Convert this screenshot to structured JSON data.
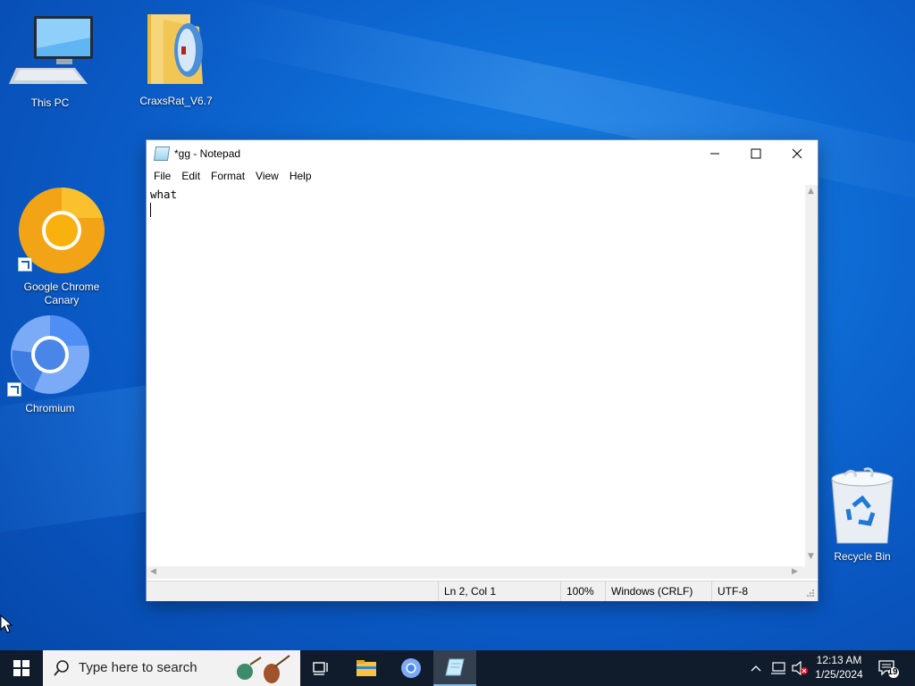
{
  "desktop": {
    "icons": [
      {
        "label": "This PC"
      },
      {
        "label": "CraxsRat_V6.7"
      },
      {
        "label_line1": "Google Chrome",
        "label_line2": "Canary"
      },
      {
        "label": "Chromium"
      },
      {
        "label": "Recycle Bin"
      }
    ]
  },
  "notepad": {
    "title": "*gg - Notepad",
    "menu": [
      "File",
      "Edit",
      "Format",
      "View",
      "Help"
    ],
    "content": "what",
    "status": {
      "position": "Ln 2, Col 1",
      "zoom": "100%",
      "line_ending": "Windows (CRLF)",
      "encoding": "UTF-8"
    }
  },
  "taskbar": {
    "search_placeholder": "Type here to search",
    "time": "12:13 AM",
    "date": "1/25/2024",
    "notification_count": "19"
  },
  "colors": {
    "accent": "#76b9ed",
    "taskbar_bg": "#101c2c",
    "desktop_bg": "#0a59c4"
  }
}
